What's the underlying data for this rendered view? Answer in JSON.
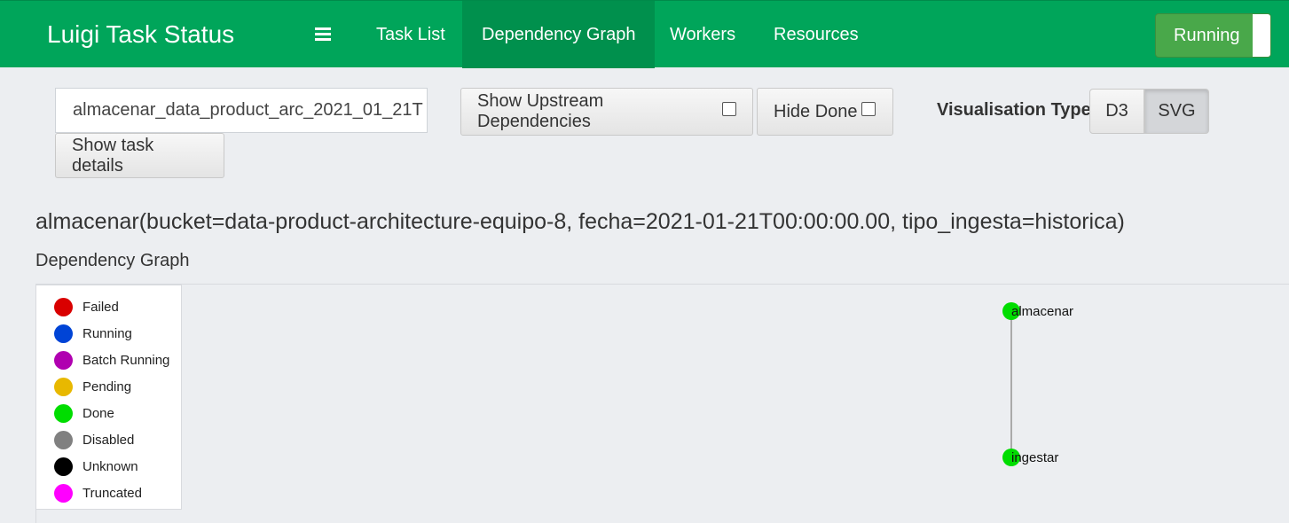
{
  "navbar": {
    "brand": "Luigi Task Status",
    "items": [
      {
        "label": "Task List"
      },
      {
        "label": "Dependency Graph"
      },
      {
        "label": "Workers"
      },
      {
        "label": "Resources"
      }
    ],
    "toggle_label": "Running"
  },
  "controls": {
    "task_value": "almacenar_data_product_arc_2021_01_21T",
    "show_upstream_label": "Show Upstream Dependencies",
    "hide_done_label": "Hide Done",
    "show_details_label": "Show task details",
    "vis_type_label": "Visualisation Type",
    "vis_options": [
      "D3",
      "SVG"
    ],
    "vis_selected": "SVG"
  },
  "task_title": "almacenar(bucket=data-product-architecture-equipo-8, fecha=2021-01-21T00:00:00.00, tipo_ingesta=historica)",
  "graph_label": "Dependency Graph",
  "legend": [
    {
      "label": "Failed",
      "color": "#d90000"
    },
    {
      "label": "Running",
      "color": "#0044d6"
    },
    {
      "label": "Batch Running",
      "color": "#b000b0"
    },
    {
      "label": "Pending",
      "color": "#e8b800"
    },
    {
      "label": "Done",
      "color": "#00dd00"
    },
    {
      "label": "Disabled",
      "color": "#808080"
    },
    {
      "label": "Unknown",
      "color": "#000000"
    },
    {
      "label": "Truncated",
      "color": "#ff00ff"
    }
  ],
  "graph": {
    "nodes": [
      {
        "label": "almacenar",
        "status": "Done",
        "color": "#00dd00"
      },
      {
        "label": "ingestar",
        "status": "Done",
        "color": "#00dd00"
      }
    ]
  }
}
